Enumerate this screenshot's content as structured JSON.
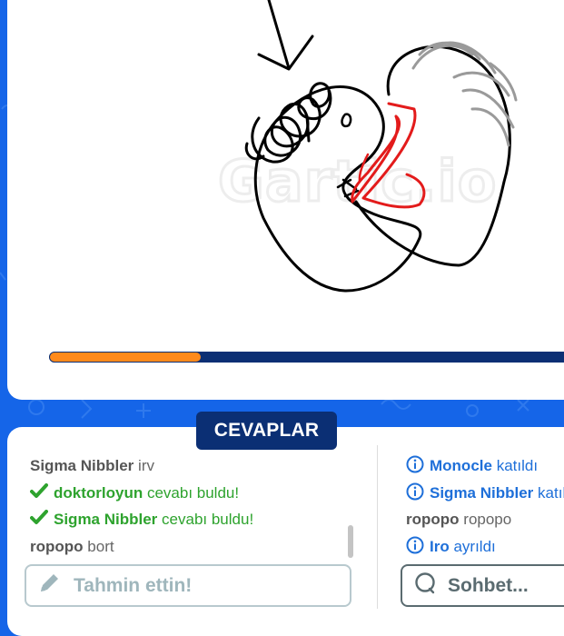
{
  "watermark": "Gartic.io",
  "answers": {
    "tab_label": "CEVAPLAR",
    "messages": [
      {
        "name": "Sigma Nibbler",
        "text": "irv",
        "type": "guess"
      },
      {
        "name": "doktorloyun",
        "text": "cevabı buldu!",
        "type": "success"
      },
      {
        "name": "Sigma Nibbler",
        "text": "cevabı buldu!",
        "type": "success"
      },
      {
        "name": "ropopo",
        "text": "bort",
        "type": "guess"
      }
    ],
    "input_placeholder": "Tahmin ettin!"
  },
  "chat": {
    "messages": [
      {
        "name": "Monocle",
        "text": "katıldı",
        "type": "info"
      },
      {
        "name": "Sigma Nibbler",
        "text": "katıldı",
        "type": "info"
      },
      {
        "name": "ropopo",
        "text": "ropopo",
        "type": "plain"
      },
      {
        "name": "Iro",
        "text": "ayrıldı",
        "type": "info"
      }
    ],
    "input_placeholder": "Sohbet..."
  },
  "round_progress_fraction": 0.28,
  "colors": {
    "background": "#1565e8",
    "accent_dark": "#0b2f74",
    "progress": "#ff8a1c",
    "success": "#2ea32e",
    "info": "#1e6fd9"
  }
}
